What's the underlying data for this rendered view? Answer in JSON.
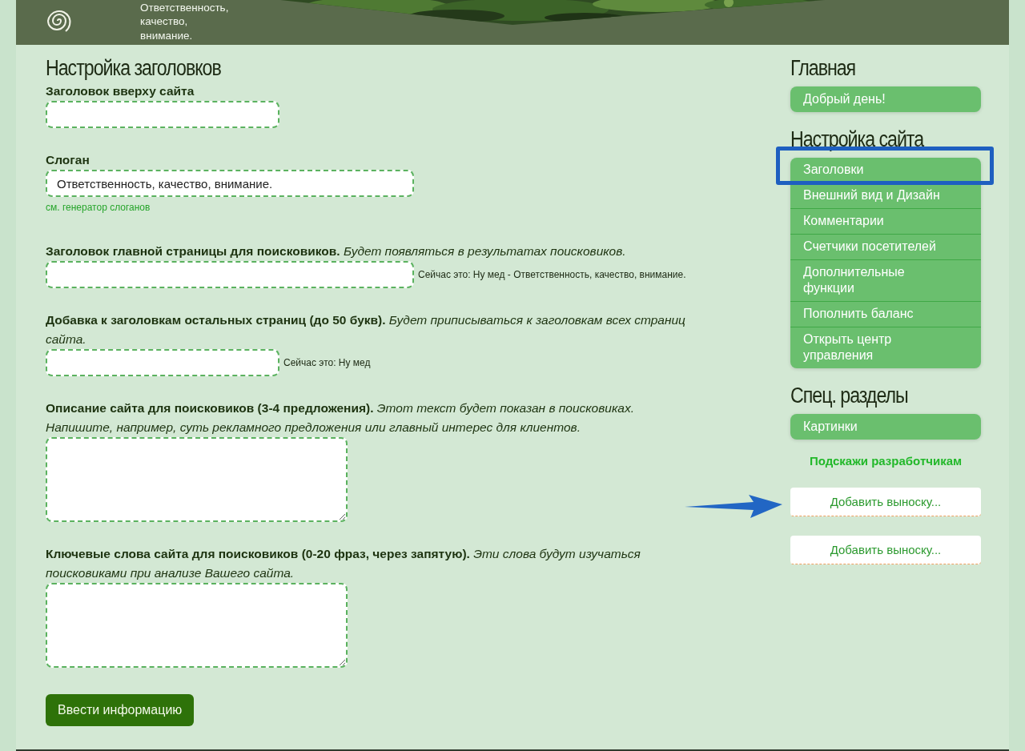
{
  "header": {
    "slogan": [
      "Ответственность,",
      "качество,",
      "внимание."
    ]
  },
  "form": {
    "title": "Настройка заголовков",
    "fields": [
      {
        "kind": "short-input",
        "label": "Заголовок вверху сайта"
      },
      {
        "kind": "wide-input",
        "label": "Слоган",
        "value": "Ответственность, качество, внимание.",
        "link": "см. генератор слоганов"
      },
      {
        "kind": "wide-input",
        "label": "Заголовок главной страницы для поисковиков. *Будет появляться в результатах поисковиков.*",
        "current": "Сейчас это: Ну мед - Ответственность, качество, внимание."
      },
      {
        "kind": "short-input",
        "label": "Добавка к заголовкам остальных страниц (до 50 букв). *Будет приписываться к заголовкам всех страниц сайта.*",
        "current": "Сейчас это: Ну мед"
      },
      {
        "kind": "textarea",
        "label": "Описание сайта для поисковиков (3-4 предложения). *Этот текст будет показан в поисковиках. Напишите, например, суть рекламного предложения или главный интерес для клиентов.*"
      },
      {
        "kind": "textarea",
        "label": "Ключевые слова сайта для поисковиков (0-20 фраз, через запятую). *Эти слова будут изучаться поисковиками при анализе Вашего сайта.*"
      }
    ],
    "submit": "Ввести информацию"
  },
  "sidebar": {
    "sections": [
      {
        "title": "Главная",
        "items": [
          {
            "label": "Добрый день!"
          }
        ]
      },
      {
        "title": "Настройка сайта",
        "items": [
          {
            "label": "Заголовки"
          },
          {
            "label": "Внешний вид и Дизайн"
          },
          {
            "label": "Комментарии"
          },
          {
            "label": "Счетчики посетителей"
          },
          {
            "label": "Дополнительные функции"
          },
          {
            "label": "Пополнить баланс"
          },
          {
            "label": "Открыть центр управления"
          }
        ]
      },
      {
        "title": "Спец. разделы",
        "items": [
          {
            "label": "Картинки"
          }
        ]
      }
    ],
    "feedback_link": "Подскажи разработчикам",
    "callouts": [
      "Добавить выноску...",
      "Добавить выноску..."
    ]
  }
}
